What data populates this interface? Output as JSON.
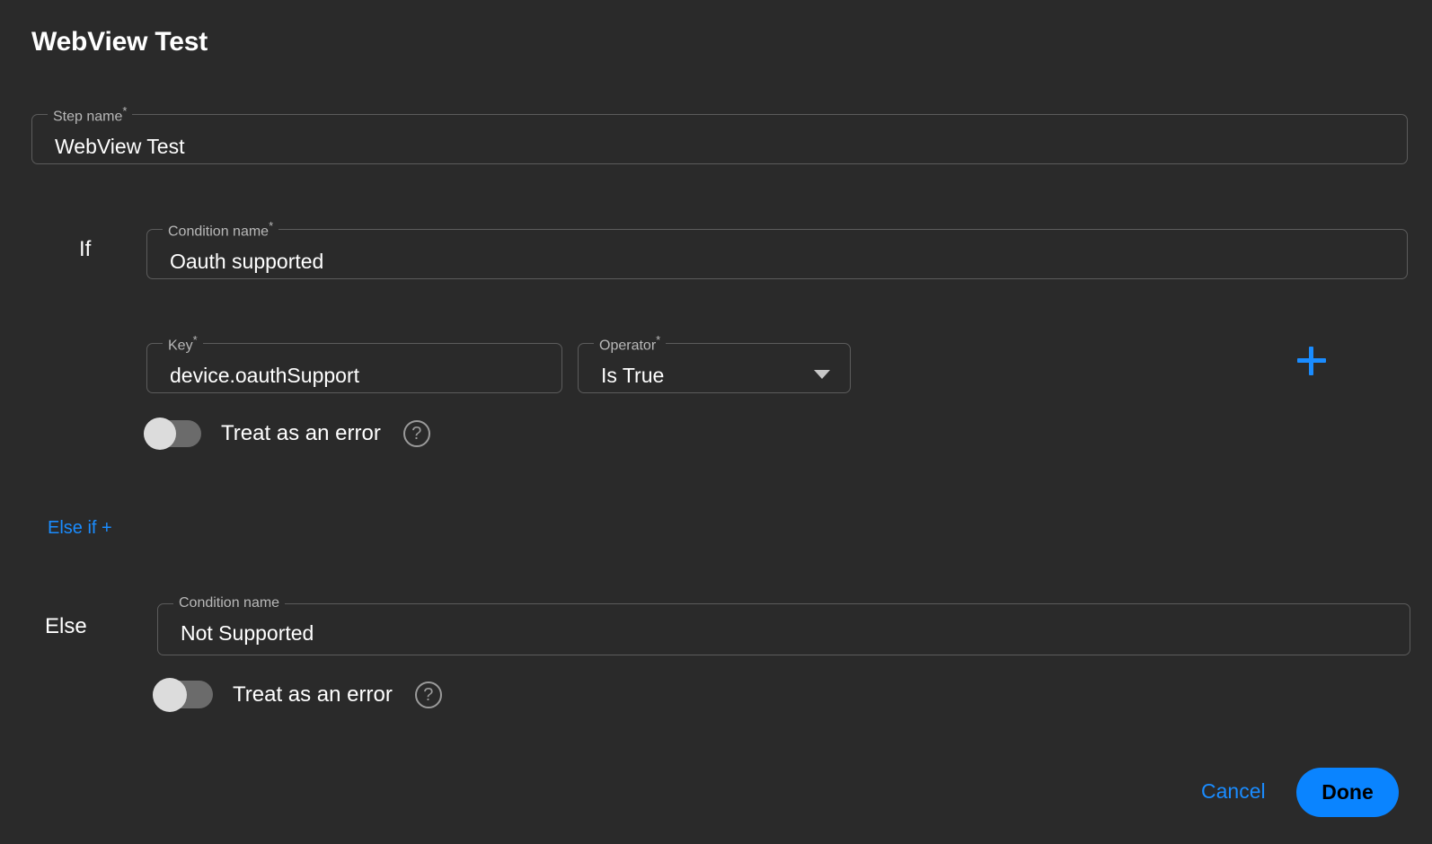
{
  "page": {
    "title": "WebView Test",
    "background_color": "#2a2a2a",
    "accent_color": "#1a8cff"
  },
  "step_name": {
    "label": "Step name",
    "required_marker": "*",
    "value": "WebView Test"
  },
  "if_branch": {
    "keyword": "If",
    "condition": {
      "label": "Condition name",
      "required_marker": "*",
      "value": "Oauth supported"
    },
    "key": {
      "label": "Key",
      "required_marker": "*",
      "value": "device.oauthSupport"
    },
    "operator": {
      "label": "Operator",
      "required_marker": "*",
      "value": "Is True"
    },
    "add_condition_icon": "plus-icon",
    "treat_as_error": {
      "label": "Treat as an error",
      "state": "off",
      "help_icon": "question-mark-icon"
    }
  },
  "else_if": {
    "label": "Else if +"
  },
  "else_branch": {
    "keyword": "Else",
    "condition": {
      "label": "Condition name",
      "value": "Not Supported"
    },
    "treat_as_error": {
      "label": "Treat as an error",
      "state": "off",
      "help_icon": "question-mark-icon"
    }
  },
  "footer": {
    "cancel_label": "Cancel",
    "done_label": "Done"
  }
}
